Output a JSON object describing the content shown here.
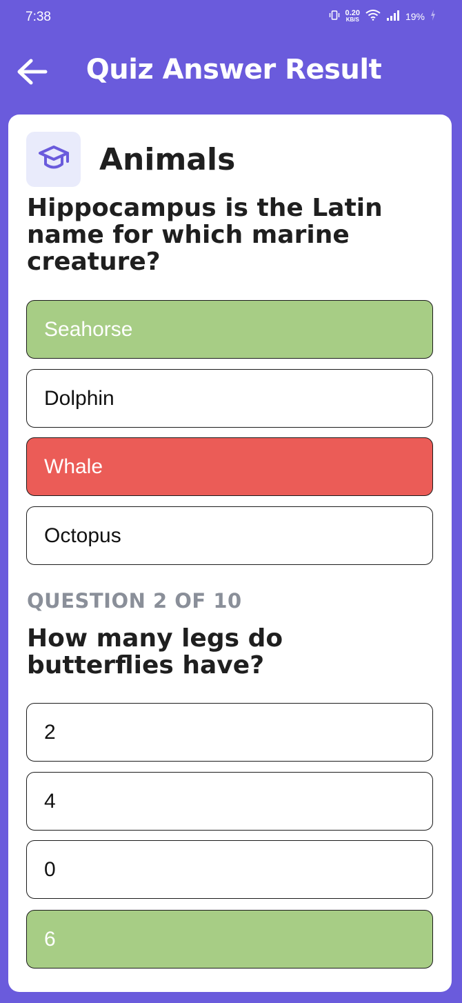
{
  "status_bar": {
    "time": "7:38",
    "net_speed_value": "0.20",
    "net_speed_unit": "KB/S",
    "battery": "19%"
  },
  "app_bar": {
    "title": "Quiz Answer Result"
  },
  "category": {
    "name": "Animals",
    "icon": "graduation-cap-icon"
  },
  "questions": [
    {
      "text": "Hippocampus is the Latin name for which marine creature?",
      "options": [
        {
          "label": "Seahorse",
          "state": "correct"
        },
        {
          "label": "Dolphin",
          "state": "neutral"
        },
        {
          "label": "Whale",
          "state": "wrong"
        },
        {
          "label": "Octopus",
          "state": "neutral"
        }
      ]
    },
    {
      "label": "QUESTION 2 OF 10",
      "text": "How many legs do butterflies have?",
      "options": [
        {
          "label": "2",
          "state": "neutral"
        },
        {
          "label": "4",
          "state": "neutral"
        },
        {
          "label": "0",
          "state": "neutral"
        },
        {
          "label": "6",
          "state": "correct"
        }
      ]
    }
  ],
  "colors": {
    "primary": "#6a5bdc",
    "correct": "#a7cd85",
    "wrong": "#eb5c57",
    "card": "#ffffff",
    "icon_bg": "#e9ebfb"
  }
}
